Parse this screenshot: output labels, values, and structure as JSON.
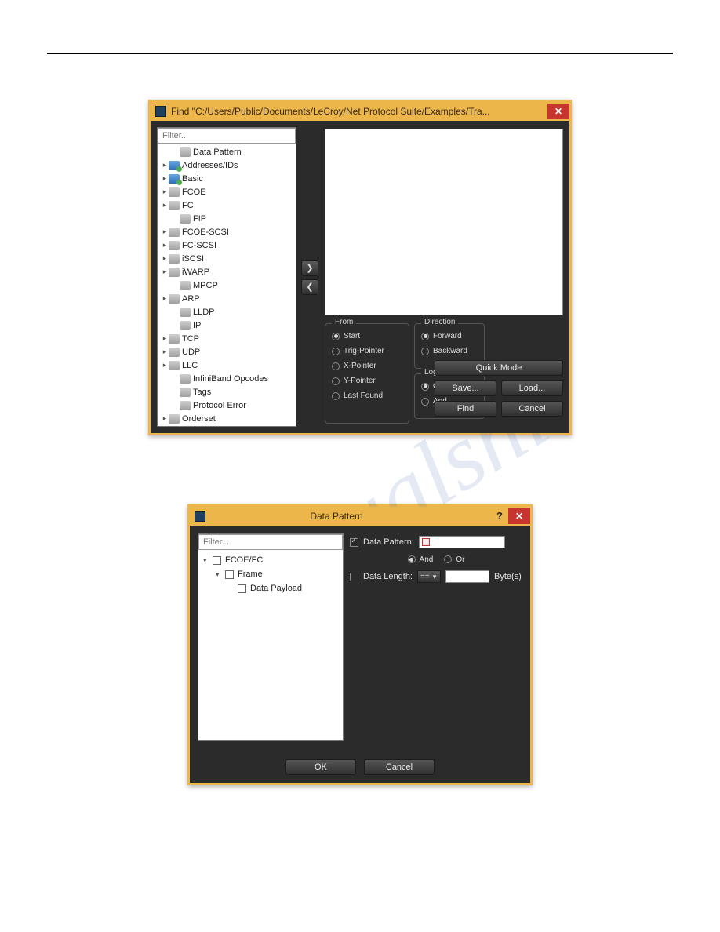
{
  "find_dialog": {
    "title": "Find \"C:/Users/Public/Documents/LeCroy/Net Protocol Suite/Examples/Tra...",
    "filter_placeholder": "Filter...",
    "tree": [
      {
        "arrow": "",
        "icon": "gray",
        "label": "Data Pattern",
        "indent": 14
      },
      {
        "arrow": "▸",
        "icon": "blue",
        "label": "Addresses/IDs",
        "indent": 0
      },
      {
        "arrow": "▸",
        "icon": "blue",
        "label": "Basic",
        "indent": 0
      },
      {
        "arrow": "▸",
        "icon": "gray",
        "label": "FCOE",
        "indent": 0
      },
      {
        "arrow": "▸",
        "icon": "gray",
        "label": "FC",
        "indent": 0
      },
      {
        "arrow": "",
        "icon": "gray",
        "label": "FIP",
        "indent": 14
      },
      {
        "arrow": "▸",
        "icon": "gray",
        "label": "FCOE-SCSI",
        "indent": 0
      },
      {
        "arrow": "▸",
        "icon": "gray",
        "label": "FC-SCSI",
        "indent": 0
      },
      {
        "arrow": "▸",
        "icon": "gray",
        "label": "iSCSI",
        "indent": 0
      },
      {
        "arrow": "▸",
        "icon": "gray",
        "label": "iWARP",
        "indent": 0
      },
      {
        "arrow": "",
        "icon": "gray",
        "label": "MPCP",
        "indent": 14
      },
      {
        "arrow": "▸",
        "icon": "gray",
        "label": "ARP",
        "indent": 0
      },
      {
        "arrow": "",
        "icon": "gray",
        "label": "LLDP",
        "indent": 14
      },
      {
        "arrow": "",
        "icon": "gray",
        "label": "IP",
        "indent": 14
      },
      {
        "arrow": "▸",
        "icon": "gray",
        "label": "TCP",
        "indent": 0
      },
      {
        "arrow": "▸",
        "icon": "gray",
        "label": "UDP",
        "indent": 0
      },
      {
        "arrow": "▸",
        "icon": "gray",
        "label": "LLC",
        "indent": 0
      },
      {
        "arrow": "",
        "icon": "gray",
        "label": "InfiniBand Opcodes",
        "indent": 14
      },
      {
        "arrow": "",
        "icon": "gray",
        "label": "Tags",
        "indent": 14
      },
      {
        "arrow": "",
        "icon": "gray",
        "label": "Protocol Error",
        "indent": 14
      },
      {
        "arrow": "▸",
        "icon": "gray",
        "label": "Orderset",
        "indent": 0
      }
    ],
    "arrow_right": "❯",
    "arrow_left": "❮",
    "from": {
      "legend": "From",
      "options": [
        "Start",
        "Trig-Pointer",
        "X-Pointer",
        "Y-Pointer",
        "Last Found"
      ],
      "selected": "Start"
    },
    "direction": {
      "legend": "Direction",
      "options": [
        "Forward",
        "Backward"
      ],
      "selected": "Forward"
    },
    "logic": {
      "legend": "Logic",
      "options": [
        "Or",
        "And"
      ],
      "selected": "Or"
    },
    "buttons": {
      "quick_mode": "Quick Mode",
      "save": "Save...",
      "load": "Load...",
      "find": "Find",
      "cancel": "Cancel"
    }
  },
  "dp_dialog": {
    "title": "Data Pattern",
    "filter_placeholder": "Filter...",
    "tree": {
      "n0": {
        "label": "FCOE/FC"
      },
      "n1": {
        "label": "Frame"
      },
      "n2": {
        "label": "Data Payload"
      }
    },
    "fields": {
      "data_pattern_label": "Data Pattern:",
      "and_label": "And",
      "or_label": "Or",
      "data_length_label": "Data Length:",
      "op": "==",
      "unit": "Byte(s)"
    },
    "buttons": {
      "ok": "OK",
      "cancel": "Cancel"
    }
  }
}
